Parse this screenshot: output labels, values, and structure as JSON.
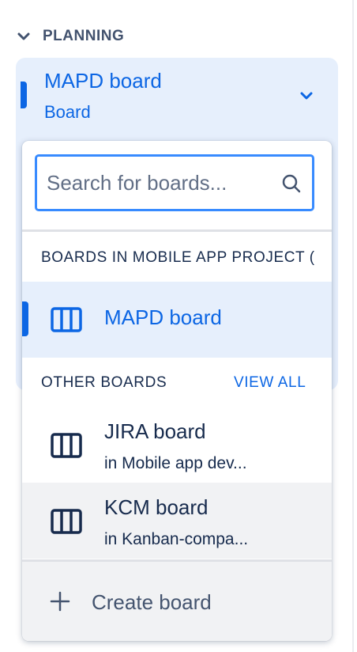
{
  "section": {
    "title": "PLANNING",
    "icon": "chevron-down-icon"
  },
  "current_board": {
    "name": "MAPD board",
    "type": "Board"
  },
  "dropdown": {
    "search": {
      "placeholder": "Search for boards...",
      "value": ""
    },
    "project_group_label": "BOARDS IN MOBILE APP PROJECT (",
    "project_boards": [
      {
        "name": "MAPD board",
        "icon": "board-icon",
        "selected": true
      }
    ],
    "other_group_label": "OTHER BOARDS",
    "view_all_label": "VIEW ALL",
    "other_boards": [
      {
        "name": "JIRA board",
        "location": "in Mobile app dev...",
        "icon": "board-icon"
      },
      {
        "name": "KCM board",
        "location": "in Kanban-compa...",
        "icon": "board-icon"
      }
    ],
    "create_label": "Create board"
  },
  "colors": {
    "accent": "#0c66e4",
    "selected_bg": "#e6effc",
    "hover_bg": "#f1f2f4",
    "focus_border": "#388bff",
    "text": "#172b4d"
  }
}
